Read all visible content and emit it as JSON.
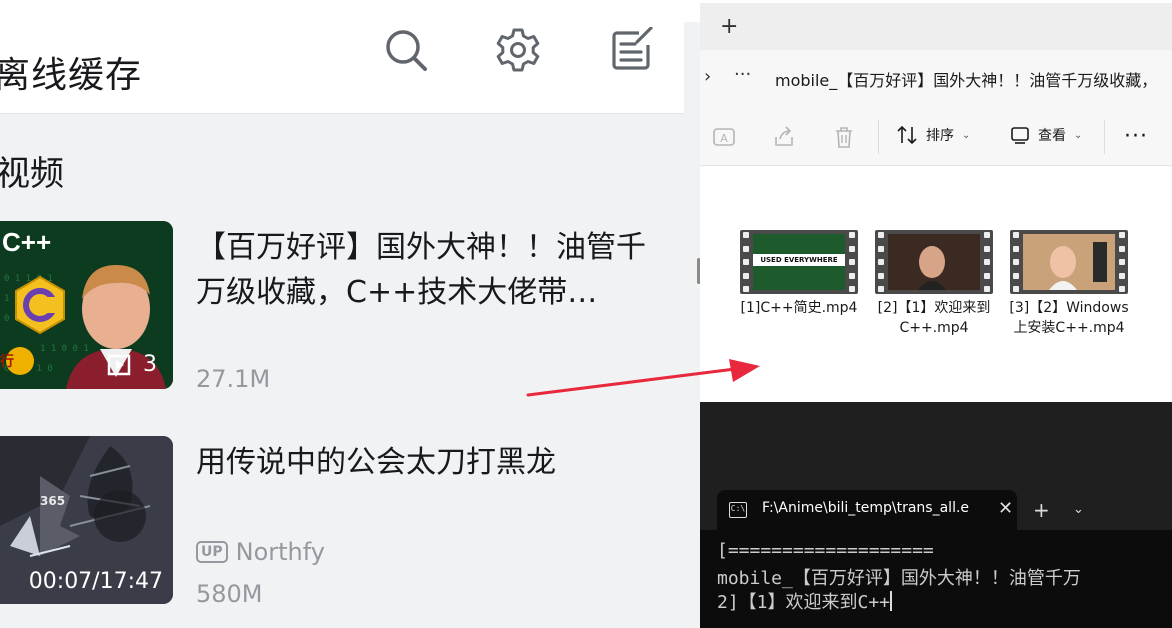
{
  "app": {
    "title": "离线缓存",
    "header_icons": [
      "search-icon",
      "gear-icon",
      "edit-icon"
    ],
    "section_title": "视频",
    "videos": [
      {
        "title": "【百万好评】国外大神！！油管千万级收藏，C++技术大佬带…",
        "size": "27.1M",
        "thumb_text": "C++",
        "episode_count": "3",
        "badge_fragment": "行"
      },
      {
        "title": "用传说中的公会太刀打黑龙",
        "uploader_badge": "UP",
        "uploader": "Northfy",
        "size": "580M",
        "duration": "00:07/17:47",
        "hud_number": "365"
      }
    ]
  },
  "explorer": {
    "new_tab_label": "+",
    "breadcrumb_chevron": "›",
    "breadcrumb_overflow": "···",
    "path": "mobile_【百万好评】国外大神！！油管千万级收藏，",
    "toolbar": {
      "sort_label": "排序",
      "view_label": "查看",
      "more_label": "···"
    },
    "files": [
      {
        "name": "[1]C++简史.mp4",
        "thumb_text": "USED EVERYWHERE"
      },
      {
        "name": "[2]【1】欢迎来到C++.mp4"
      },
      {
        "name": "[3]【2】Windows 上安装C++.mp4"
      }
    ]
  },
  "terminal": {
    "tab_title": "F:\\Anime\\bili_temp\\trans_all.e",
    "icon_text": "C:\\",
    "lines": [
      "[===================",
      "mobile_【百万好评】国外大神！！油管千万",
      "2]【1】欢迎来到C++"
    ]
  },
  "colors": {
    "app_bg": "#f1f2f3",
    "arrow": "#e8283c",
    "terminal_bg": "#0c0c0c"
  }
}
